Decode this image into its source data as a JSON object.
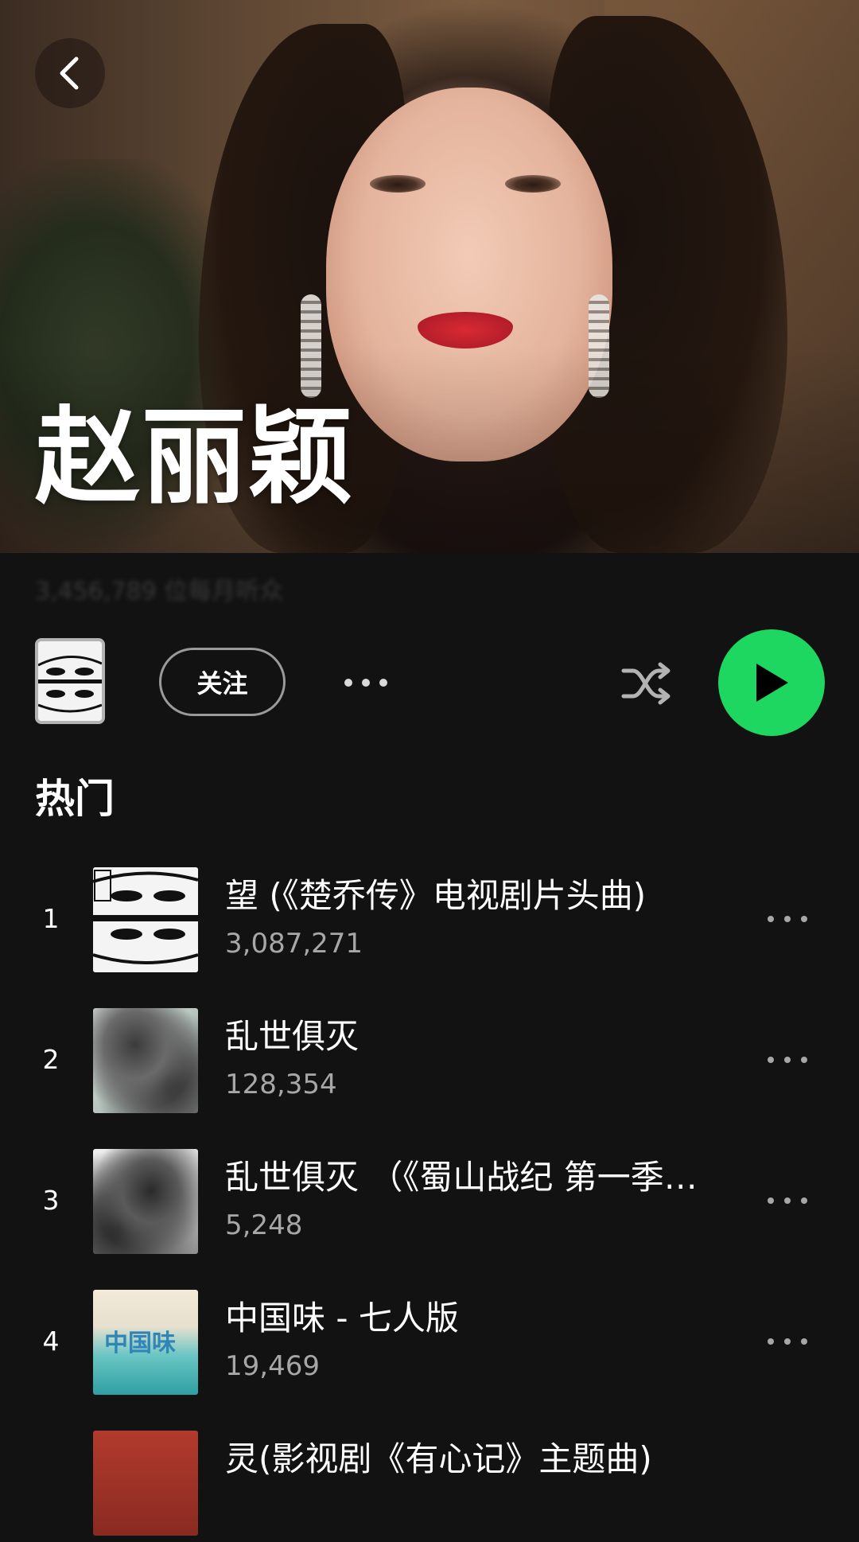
{
  "artist": {
    "name": "赵丽颖",
    "listeners_blurred": "3,456,789 位每月听众"
  },
  "actions": {
    "follow_label": "关注"
  },
  "section": {
    "title": "热门"
  },
  "tracks": [
    {
      "index": "1",
      "title": "望 (《楚乔传》电视剧片头曲)",
      "plays": "3,087,271",
      "art": "manga-art"
    },
    {
      "index": "2",
      "title": "乱世俱灭",
      "plays": "128,354",
      "art": "ink-painting-art"
    },
    {
      "index": "3",
      "title": "乱世俱灭 （《蜀山战纪 第一季…",
      "plays": "5,248",
      "art": "ink-painting-art"
    },
    {
      "index": "4",
      "title": "中国味 - 七人版",
      "plays": "19,469",
      "art": "china-flavor-art"
    },
    {
      "index": "5",
      "title": "灵(影视剧《有心记》主题曲)",
      "plays": "",
      "art": "red-cover-art"
    }
  ],
  "art_text": {
    "china_flavor": "中国味"
  },
  "colors": {
    "background": "#121212",
    "accent_green": "#1ed760",
    "secondary_text": "#a7a7a7"
  }
}
